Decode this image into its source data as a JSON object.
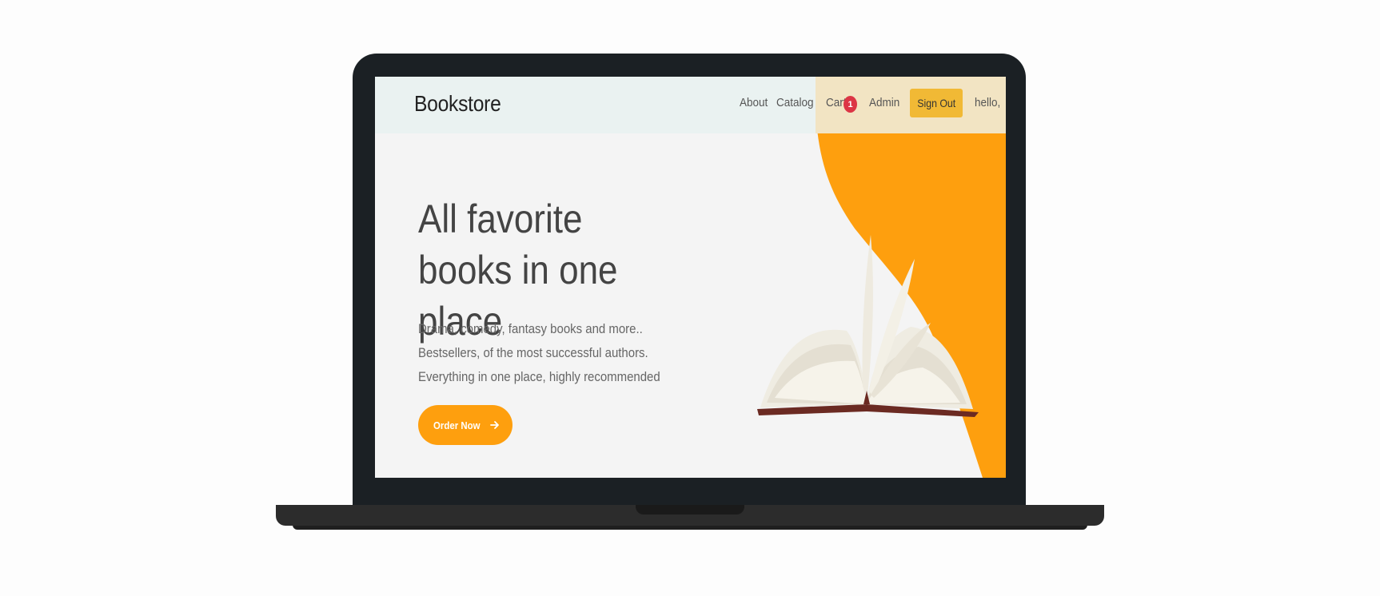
{
  "navbar": {
    "brand": "Bookstore",
    "links": {
      "about": "About",
      "catalog": "Catalog",
      "cart": "Cart",
      "admin": "Admin",
      "greeting": "hello,"
    },
    "cart_count": "1",
    "signout_label": "Sign Out"
  },
  "hero": {
    "title": "All favorite books in one place",
    "lines": [
      "Drama, comedy, fantasy books and more..",
      "Bestsellers, of the most successful authors.",
      "Everything in one place, highly recommended"
    ],
    "cta_label": "Order Now",
    "cta_icon": "arrow-right-icon"
  },
  "illustration": {
    "icon": "open-book-illustration"
  },
  "colors": {
    "accent_orange": "#fe9f0e",
    "signout_yellow": "#f1b935",
    "badge_red": "#dc3545",
    "navbar_bg": "#eaf2f1",
    "laptop_frame": "#1b2024"
  }
}
